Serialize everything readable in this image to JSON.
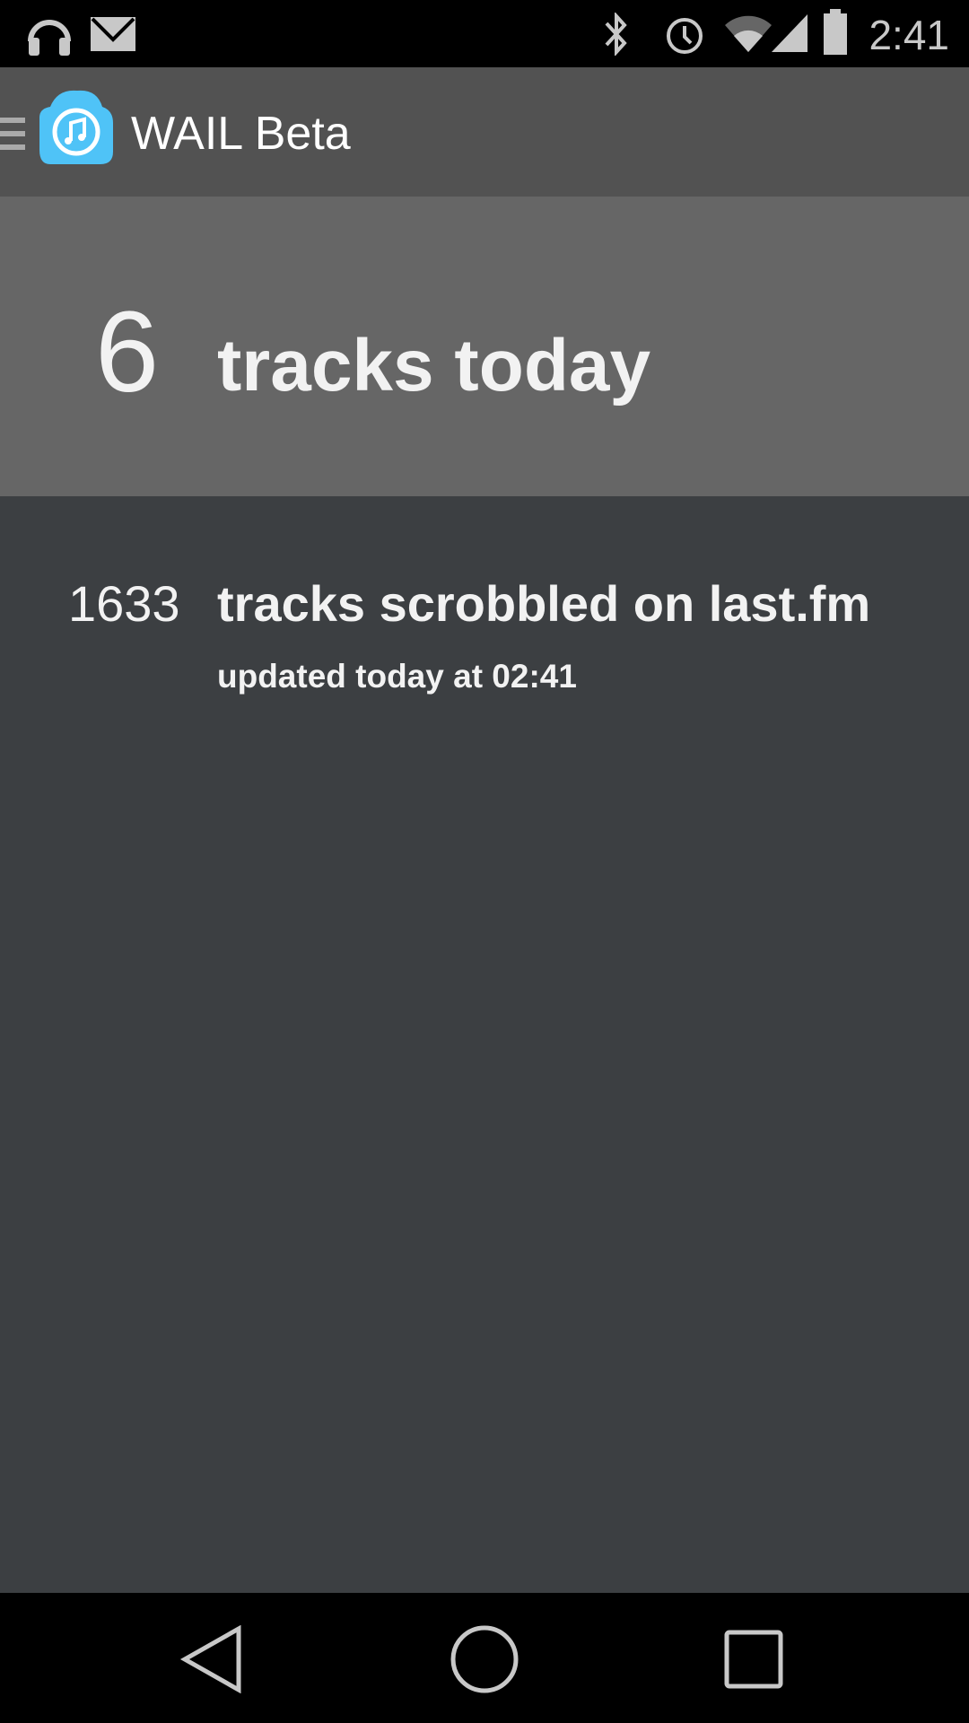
{
  "status_bar": {
    "time": "2:41",
    "icons": [
      "headphones-icon",
      "mail-icon",
      "bluetooth-icon",
      "alarm-icon",
      "wifi-icon",
      "signal-icon",
      "battery-icon"
    ]
  },
  "app_bar": {
    "title": "WAIL Beta"
  },
  "today": {
    "count": "6",
    "label": "tracks today"
  },
  "scrobbled": {
    "count": "1633",
    "label": "tracks scrobbled on last.fm",
    "updated": "updated today at 02:41"
  },
  "colors": {
    "app_bar": "#525252",
    "header": "#666666",
    "background": "#3c3f42",
    "icon_blue": "#4fc3f7"
  }
}
